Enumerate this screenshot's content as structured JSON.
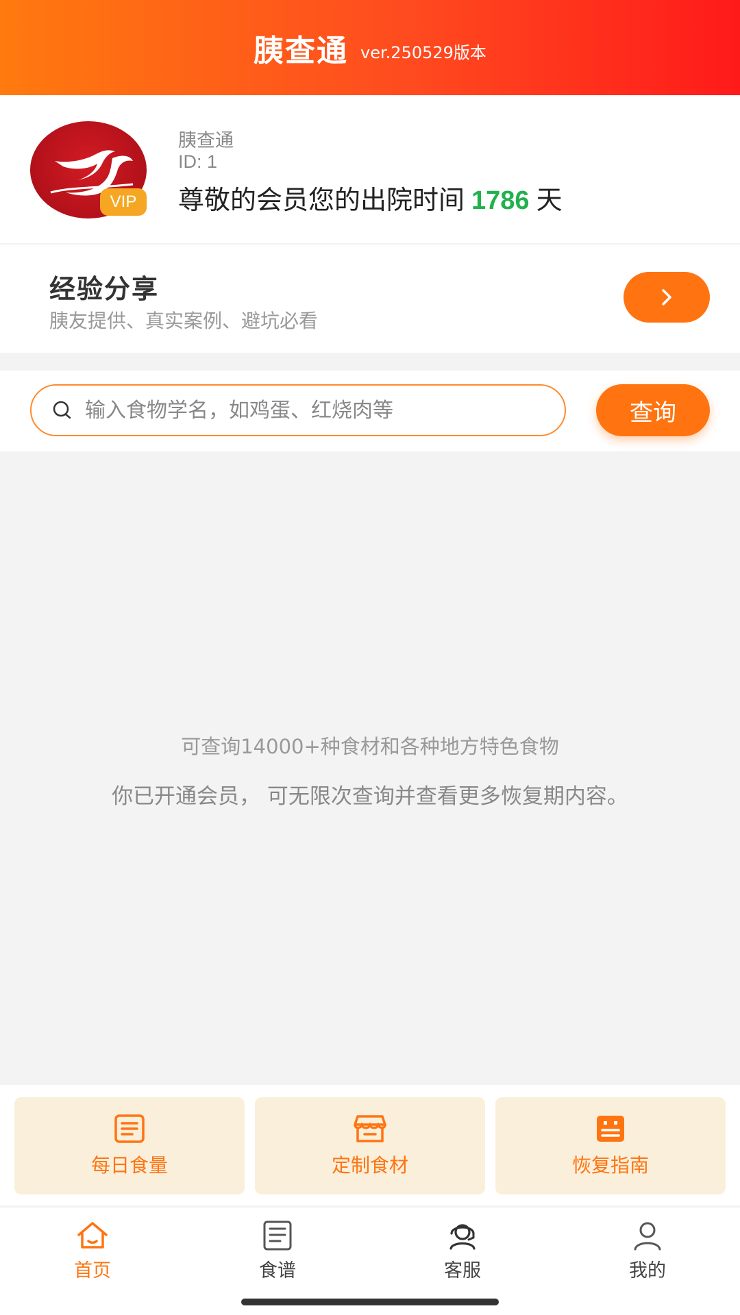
{
  "header": {
    "title": "胰查通",
    "version": "ver.250529版本"
  },
  "profile": {
    "name": "胰查通",
    "id_text": "ID: 1",
    "message_prefix": "尊敬的会员您的出院时间",
    "days": "1786",
    "message_suffix": "天",
    "vip_label": "VIP"
  },
  "experience": {
    "title": "经验分享",
    "subtitle": "胰友提供、真实案例、避坑必看"
  },
  "search": {
    "placeholder": "输入食物学名，如鸡蛋、红烧肉等",
    "value": "",
    "button_label": "查询"
  },
  "info": {
    "line1": "可查询14000+种食材和各种地方特色食物",
    "line2": "你已开通会员， 可无限次查询并查看更多恢复期内容。"
  },
  "quick_actions": [
    {
      "label": "每日食量",
      "icon": "clipboard-list-icon"
    },
    {
      "label": "定制食材",
      "icon": "store-icon"
    },
    {
      "label": "恢复指南",
      "icon": "guide-book-icon"
    }
  ],
  "nav": [
    {
      "label": "首页",
      "icon": "home-icon",
      "active": true
    },
    {
      "label": "食谱",
      "icon": "recipe-icon",
      "active": false
    },
    {
      "label": "客服",
      "icon": "customer-service-icon",
      "active": false
    },
    {
      "label": "我的",
      "icon": "user-icon",
      "active": false
    }
  ],
  "colors": {
    "accent": "#ff7410",
    "days_green": "#22b14c",
    "header_start": "#ff7a0f",
    "header_end": "#ff1a1a",
    "card_bg": "#faefdb"
  }
}
